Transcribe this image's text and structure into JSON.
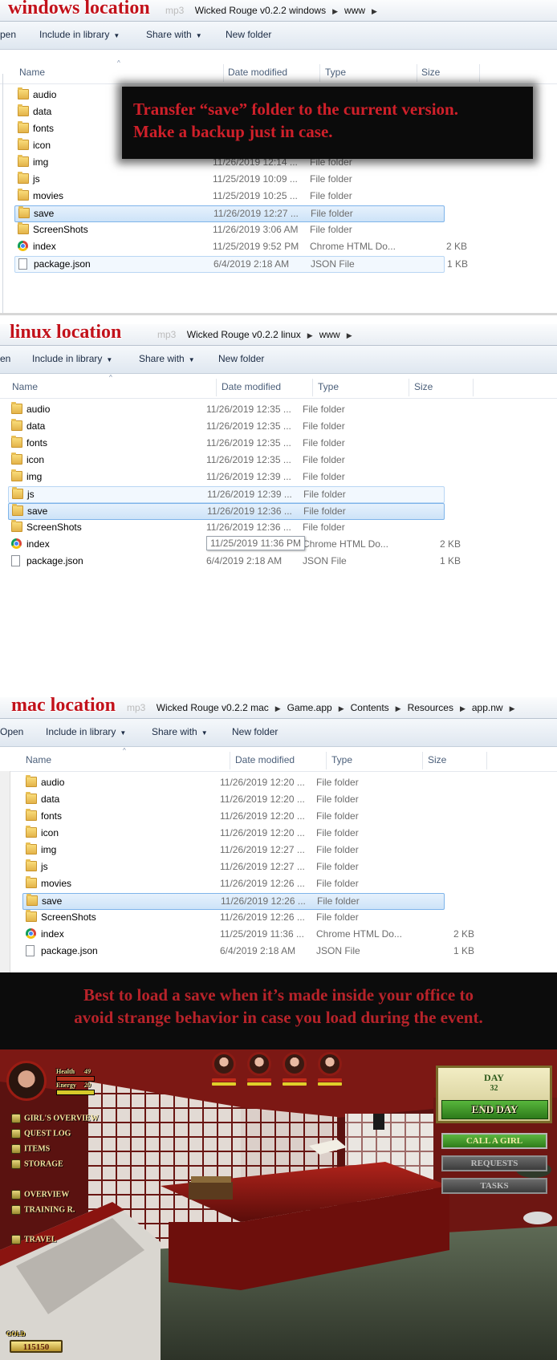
{
  "windows": {
    "label": "windows location",
    "breadcrumb": [
      "Wicked Rouge v0.2.2 windows",
      "www"
    ],
    "breadcrumb_ghost": "mp3",
    "toolbar": {
      "open": "pen",
      "include": "Include in library",
      "share": "Share with",
      "new_folder": "New folder"
    },
    "columns": {
      "name": "Name",
      "date": "Date modified",
      "type": "Type",
      "size": "Size"
    },
    "rows": [
      {
        "name": "audio",
        "date": "",
        "type": "",
        "size": "",
        "icon": "folder-icon"
      },
      {
        "name": "data",
        "date": "",
        "type": "",
        "size": "",
        "icon": "folder-icon"
      },
      {
        "name": "fonts",
        "date": "",
        "type": "",
        "size": "",
        "icon": "folder-icon"
      },
      {
        "name": "icon",
        "date": "",
        "type": "",
        "size": "",
        "icon": "folder-icon"
      },
      {
        "name": "img",
        "date": "11/26/2019 12:14 ...",
        "type": "File folder",
        "size": "",
        "icon": "folder-icon"
      },
      {
        "name": "js",
        "date": "11/25/2019 10:09 ...",
        "type": "File folder",
        "size": "",
        "icon": "folder-icon"
      },
      {
        "name": "movies",
        "date": "11/25/2019 10:25 ...",
        "type": "File folder",
        "size": "",
        "icon": "folder-icon"
      },
      {
        "name": "save",
        "date": "11/26/2019 12:27 ...",
        "type": "File folder",
        "size": "",
        "icon": "folder-icon",
        "selected": true
      },
      {
        "name": "ScreenShots",
        "date": "11/26/2019 3:06 AM",
        "type": "File folder",
        "size": "",
        "icon": "folder-icon"
      },
      {
        "name": "index",
        "date": "11/25/2019 9:52 PM",
        "type": "Chrome HTML Do...",
        "size": "2 KB",
        "icon": "chrome-icon"
      },
      {
        "name": "package.json",
        "date": "6/4/2019 2:18 AM",
        "type": "JSON File",
        "size": "1 KB",
        "icon": "file-icon",
        "hover": true
      }
    ],
    "note": [
      "Transfer “save” folder to the current version.",
      "Make a backup just in case."
    ]
  },
  "linux": {
    "label": "linux location",
    "breadcrumb": [
      "Wicked Rouge v0.2.2 linux",
      "www"
    ],
    "breadcrumb_ghost": "mp3",
    "toolbar": {
      "open": "en",
      "include": "Include in library",
      "share": "Share with",
      "new_folder": "New folder"
    },
    "columns": {
      "name": "Name",
      "date": "Date modified",
      "type": "Type",
      "size": "Size"
    },
    "rows": [
      {
        "name": "audio",
        "date": "11/26/2019 12:35 ...",
        "type": "File folder",
        "size": "",
        "icon": "folder-icon"
      },
      {
        "name": "data",
        "date": "11/26/2019 12:35 ...",
        "type": "File folder",
        "size": "",
        "icon": "folder-icon"
      },
      {
        "name": "fonts",
        "date": "11/26/2019 12:35 ...",
        "type": "File folder",
        "size": "",
        "icon": "folder-icon"
      },
      {
        "name": "icon",
        "date": "11/26/2019 12:35 ...",
        "type": "File folder",
        "size": "",
        "icon": "folder-icon"
      },
      {
        "name": "img",
        "date": "11/26/2019 12:39 ...",
        "type": "File folder",
        "size": "",
        "icon": "folder-icon"
      },
      {
        "name": "js",
        "date": "11/26/2019 12:39 ...",
        "type": "File folder",
        "size": "",
        "icon": "folder-icon",
        "hover": true
      },
      {
        "name": "save",
        "date": "11/26/2019 12:36 ...",
        "type": "File folder",
        "size": "",
        "icon": "folder-icon",
        "selected": true
      },
      {
        "name": "ScreenShots",
        "date": "11/26/2019 12:36 ...",
        "type": "File folder",
        "size": "",
        "icon": "folder-icon"
      },
      {
        "name": "index",
        "date": "11/25/2019 11:36 PM",
        "type": "Chrome HTML Do...",
        "size": "2 KB",
        "icon": "chrome-icon",
        "tooltip": true
      },
      {
        "name": "package.json",
        "date": "6/4/2019 2:18 AM",
        "type": "JSON File",
        "size": "1 KB",
        "icon": "file-icon"
      }
    ]
  },
  "mac": {
    "label": "mac location",
    "breadcrumb": [
      "Wicked Rouge v0.2.2 mac",
      "Game.app",
      "Contents",
      "Resources",
      "app.nw"
    ],
    "breadcrumb_ghost": "mp3",
    "toolbar": {
      "open": "Open",
      "include": "Include in library",
      "share": "Share with",
      "new_folder": "New folder"
    },
    "columns": {
      "name": "Name",
      "date": "Date modified",
      "type": "Type",
      "size": "Size"
    },
    "rows": [
      {
        "name": "audio",
        "date": "11/26/2019 12:20 ...",
        "type": "File folder",
        "size": "",
        "icon": "folder-icon"
      },
      {
        "name": "data",
        "date": "11/26/2019 12:20 ...",
        "type": "File folder",
        "size": "",
        "icon": "folder-icon"
      },
      {
        "name": "fonts",
        "date": "11/26/2019 12:20 ...",
        "type": "File folder",
        "size": "",
        "icon": "folder-icon"
      },
      {
        "name": "icon",
        "date": "11/26/2019 12:20 ...",
        "type": "File folder",
        "size": "",
        "icon": "folder-icon"
      },
      {
        "name": "img",
        "date": "11/26/2019 12:27 ...",
        "type": "File folder",
        "size": "",
        "icon": "folder-icon"
      },
      {
        "name": "js",
        "date": "11/26/2019 12:27 ...",
        "type": "File folder",
        "size": "",
        "icon": "folder-icon"
      },
      {
        "name": "movies",
        "date": "11/26/2019 12:26 ...",
        "type": "File folder",
        "size": "",
        "icon": "folder-icon"
      },
      {
        "name": "save",
        "date": "11/26/2019 12:26 ...",
        "type": "File folder",
        "size": "",
        "icon": "folder-icon",
        "selected": true
      },
      {
        "name": "ScreenShots",
        "date": "11/26/2019 12:26 ...",
        "type": "File folder",
        "size": "",
        "icon": "folder-icon"
      },
      {
        "name": "index",
        "date": "11/25/2019 11:36 ...",
        "type": "Chrome HTML Do...",
        "size": "2 KB",
        "icon": "chrome-icon"
      },
      {
        "name": "package.json",
        "date": "6/4/2019 2:18 AM",
        "type": "JSON File",
        "size": "1 KB",
        "icon": "file-icon"
      }
    ]
  },
  "tip": [
    "Best to load a save when it’s made inside your office to",
    "avoid strange behavior in case you load during the event."
  ],
  "game": {
    "stats": {
      "health_label": "Health",
      "health_value": "49",
      "energy_label": "Energy",
      "energy_value": "20"
    },
    "menu": [
      "GIRL'S OVERVIEW",
      "QUEST LOG",
      "ITEMS",
      "STORAGE",
      "OVERVIEW",
      "TRAINING R.",
      "TRAVEL"
    ],
    "day_label": "DAY",
    "day_value": "32",
    "end_day": "END DAY",
    "actions": [
      "CALL A GIRL",
      "REQUESTS",
      "TASKS"
    ],
    "gold_label": "GOLD",
    "gold_value": "115150",
    "girl_count": 4,
    "colors": {
      "accent_red": "#c2121b",
      "gold": "#f3e39a",
      "green_button": "#3f9a2a",
      "selection": "#cde3f8"
    }
  }
}
